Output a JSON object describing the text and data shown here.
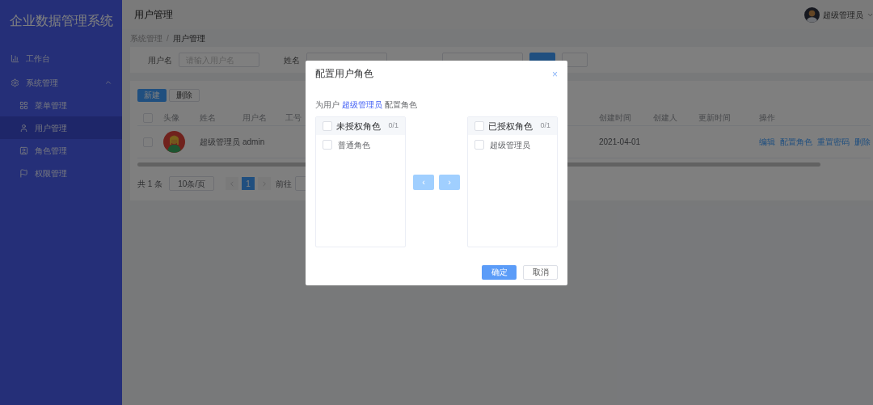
{
  "sidebar": {
    "title": "企业数据管理系统",
    "items": [
      {
        "label": "工作台",
        "kind": "chart",
        "selected": false
      },
      {
        "label": "系统管理",
        "kind": "gear",
        "selected": false,
        "expanded": true,
        "children": [
          {
            "label": "菜单管理",
            "kind": "grid",
            "selected": false
          },
          {
            "label": "用户管理",
            "kind": "user",
            "selected": true
          },
          {
            "label": "角色管理",
            "kind": "role",
            "selected": false
          },
          {
            "label": "权限管理",
            "kind": "flag",
            "selected": false
          }
        ]
      }
    ]
  },
  "header": {
    "title": "用户管理",
    "user": "超级管理员"
  },
  "breadcrumb": {
    "separator": "/",
    "items": [
      "系统管理",
      "用户管理"
    ]
  },
  "search": {
    "fields": [
      {
        "label": "用户名",
        "placeholder": "请输入用户名"
      },
      {
        "label": "姓名"
      }
    ]
  },
  "toolbar": [
    {
      "label": "新建",
      "kind": "primary"
    },
    {
      "label": "删除",
      "kind": "default"
    }
  ],
  "table": {
    "all_checked": false,
    "columns": [
      "头像",
      "姓名",
      "用户名",
      "工号",
      "创建时间",
      "创建人",
      "更新时间",
      "操作"
    ],
    "rows": [
      {
        "checked": false,
        "name": "超级管理员",
        "username": "admin",
        "created": "2021-04-01",
        "actions": [
          "编辑",
          "配置角色",
          "重置密码",
          "删除"
        ]
      }
    ]
  },
  "pagination": {
    "total": "共 1 条",
    "page_size": "10条/页",
    "pages": [
      {
        "label": "1",
        "selected": true
      }
    ],
    "goto": "前往"
  },
  "dialog": {
    "title": "配置用户角色",
    "close": "×",
    "subtitle": "为用户 **超级管理员** 配置角色",
    "panels": [
      {
        "title": "未授权角色",
        "count": "0/1",
        "checked": false,
        "items": [
          {
            "label": "普通角色",
            "checked": false
          }
        ]
      },
      {
        "title": "已授权角色",
        "count": "0/1",
        "checked": false,
        "items": [
          {
            "label": "超级管理员",
            "checked": false
          }
        ]
      }
    ],
    "arrows": [
      {
        "label": "‹",
        "disabled": true
      },
      {
        "label": "›",
        "disabled": true
      }
    ],
    "buttons": [
      {
        "label": "确定",
        "kind": "primary"
      },
      {
        "label": "取消",
        "kind": "default"
      }
    ]
  }
}
